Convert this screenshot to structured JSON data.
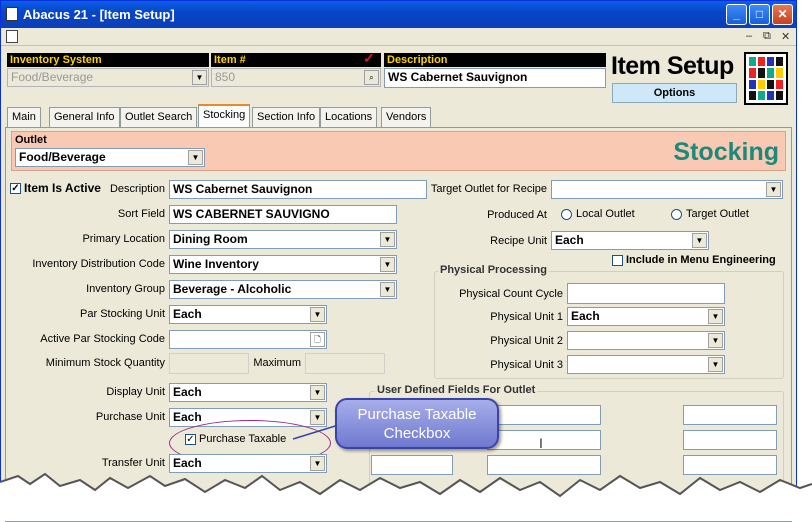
{
  "window": {
    "title": "Abacus 21 - [Item Setup]"
  },
  "header": {
    "inventory_system_label": "Inventory System",
    "inventory_system_value": "Food/Beverage",
    "item_no_label": "Item #",
    "item_no_value": "850",
    "description_label": "Description",
    "description_value": "WS Cabernet Sauvignon",
    "page_title": "Item Setup",
    "options_label": "Options"
  },
  "tabs": [
    "Main",
    "General Info",
    "Outlet Search",
    "Stocking",
    "Section Info",
    "Locations",
    "Vendors"
  ],
  "outlet": {
    "label": "Outlet",
    "value": "Food/Beverage",
    "banner": "Stocking"
  },
  "form": {
    "item_active_label": "Item Is Active",
    "description_label": "Description",
    "description_value": "WS Cabernet Sauvignon",
    "sort_field_label": "Sort Field",
    "sort_field_value": "WS CABERNET SAUVIGNO",
    "primary_location_label": "Primary Location",
    "primary_location_value": "Dining Room",
    "inv_dist_code_label": "Inventory Distribution Code",
    "inv_dist_code_value": "Wine Inventory",
    "inv_group_label": "Inventory Group",
    "inv_group_value": "Beverage - Alcoholic",
    "par_unit_label": "Par Stocking Unit",
    "par_unit_value": "Each",
    "active_par_code_label": "Active Par Stocking Code",
    "min_stock_label": "Minimum Stock Quantity",
    "maximum_label": "Maximum",
    "display_unit_label": "Display Unit",
    "display_unit_value": "Each",
    "purchase_unit_label": "Purchase Unit",
    "purchase_unit_value": "Each",
    "purchase_taxable_label": "Purchase Taxable",
    "transfer_unit_label": "Transfer Unit",
    "transfer_unit_value": "Each"
  },
  "right": {
    "target_outlet_label": "Target Outlet for Recipe",
    "produced_at_label": "Produced At",
    "local_outlet_label": "Local Outlet",
    "target_outlet_radio_label": "Target Outlet",
    "recipe_unit_label": "Recipe Unit",
    "recipe_unit_value": "Each",
    "include_menu_eng_label": "Include in Menu Engineering",
    "physical_processing_title": "Physical Processing",
    "physical_count_cycle_label": "Physical Count Cycle",
    "physical_unit1_label": "Physical Unit 1",
    "physical_unit1_value": "Each",
    "physical_unit2_label": "Physical Unit 2",
    "physical_unit3_label": "Physical Unit 3",
    "udf_title": "User Defined Fields For Outlet"
  },
  "callout": {
    "line1": "Purchase Taxable",
    "line2": "Checkbox"
  },
  "colors": {
    "title_bar": "#0a5fe8",
    "label_bg": "#000000",
    "label_text": "#ffd200",
    "outlet_band": "#f9c9b4",
    "stocking_banner": "#1a8a7a",
    "callout": "#7d86d6"
  }
}
